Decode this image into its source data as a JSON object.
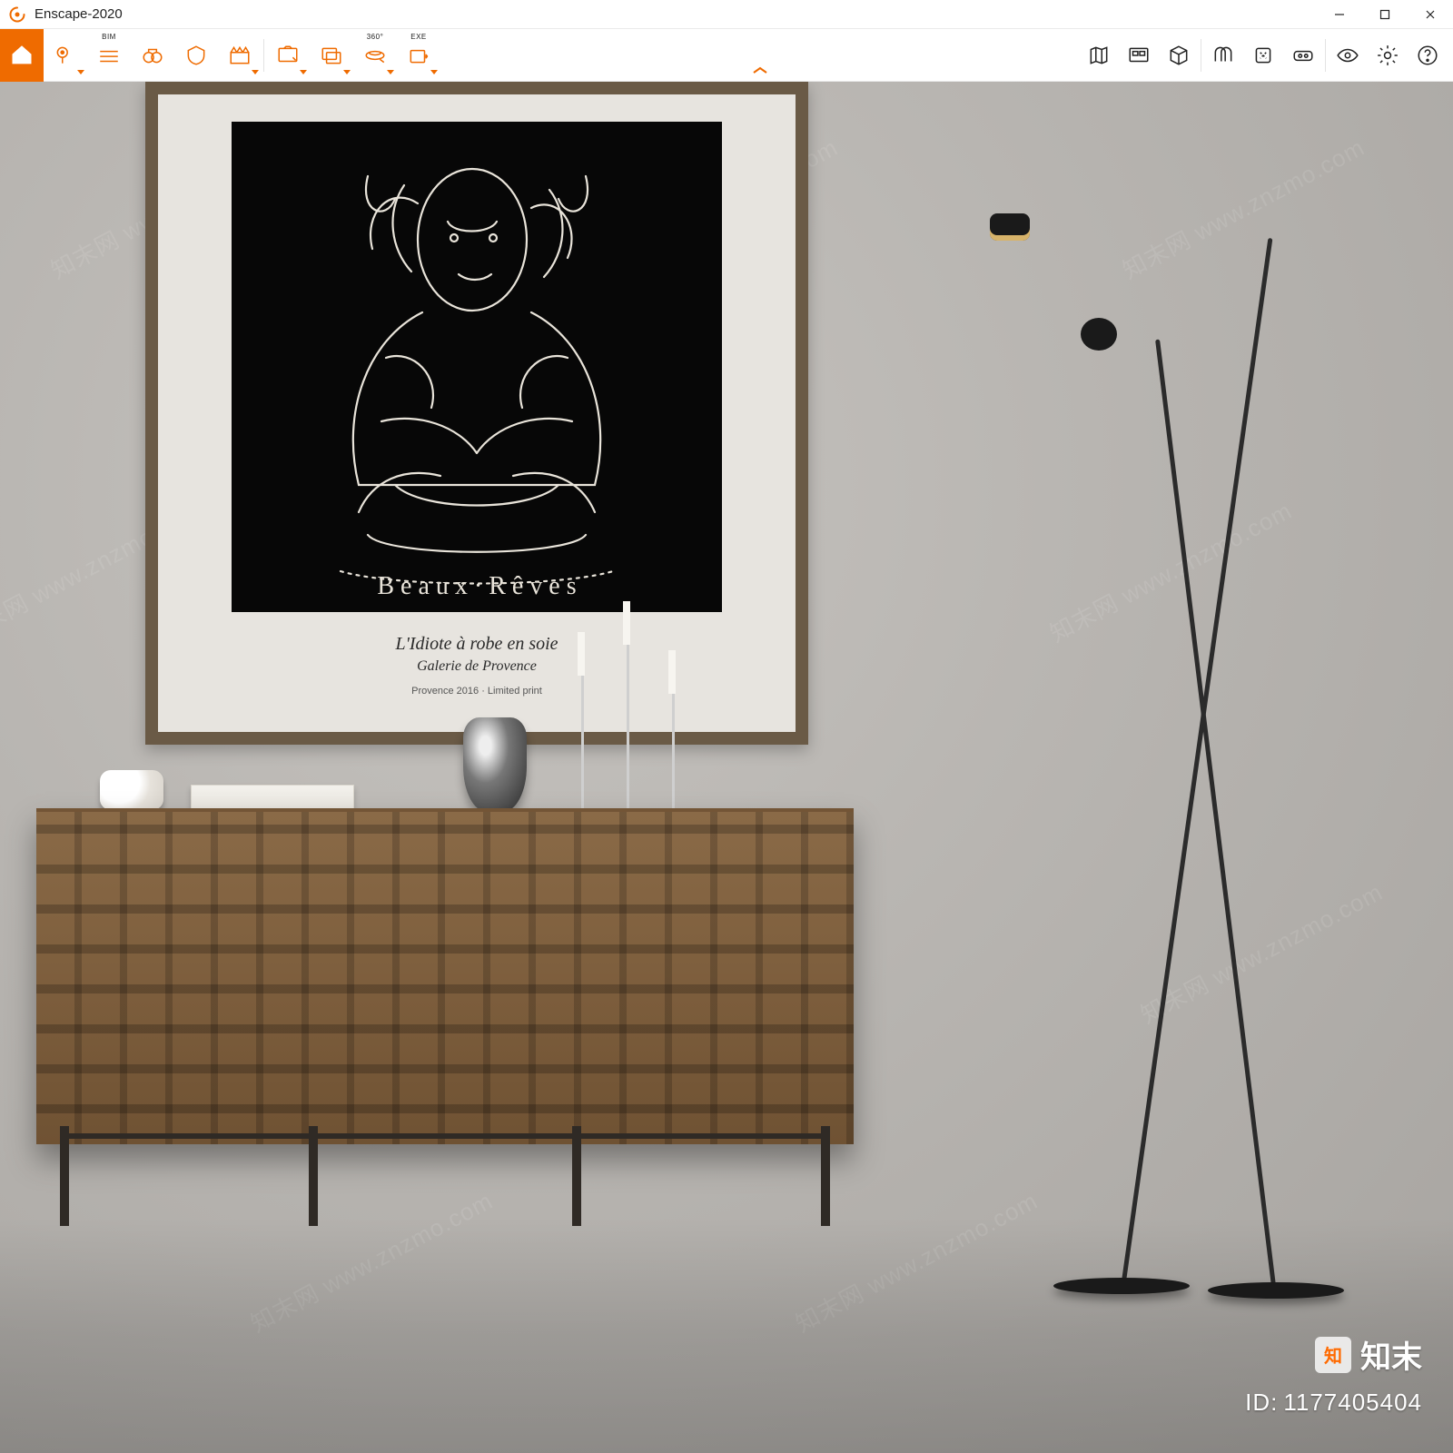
{
  "titlebar": {
    "app_name": "Enscape",
    "separator": " - ",
    "project": "2020"
  },
  "toolbar_left": {
    "home": {
      "name": "home-button"
    },
    "views": {
      "name": "favorite-views-button"
    },
    "bim": {
      "name": "bim-mode-button",
      "label": "BIM"
    },
    "binoc": {
      "name": "binoculars-button"
    },
    "safe": {
      "name": "safe-frame-button"
    },
    "clap": {
      "name": "video-path-button"
    },
    "sshot": {
      "name": "screenshot-button"
    },
    "batch": {
      "name": "batch-render-button"
    },
    "pano": {
      "name": "mono-panorama-button",
      "label": "360°"
    },
    "exe": {
      "name": "exe-standalone-button",
      "label": "EXE"
    }
  },
  "toolbar_right": {
    "map": {
      "name": "mini-map-button"
    },
    "assets": {
      "name": "asset-library-button"
    },
    "cube": {
      "name": "orbit-cube-button"
    },
    "sync": {
      "name": "synchronize-views-button"
    },
    "link": {
      "name": "live-link-button"
    },
    "vr": {
      "name": "vr-headset-button"
    },
    "visual": {
      "name": "visual-settings-button"
    },
    "settings": {
      "name": "general-settings-button"
    },
    "help": {
      "name": "help-button"
    }
  },
  "artwork": {
    "caption_line1": "L'Idiote à robe en soie",
    "caption_line2": "Galerie de Provence",
    "caption_line3": "Provence 2016 · Limited print"
  },
  "overlay": {
    "logo_text": "知末",
    "id_label": "ID:",
    "id_value": "1177405404",
    "watermark_text": "知末网 www.znzmo.com"
  }
}
